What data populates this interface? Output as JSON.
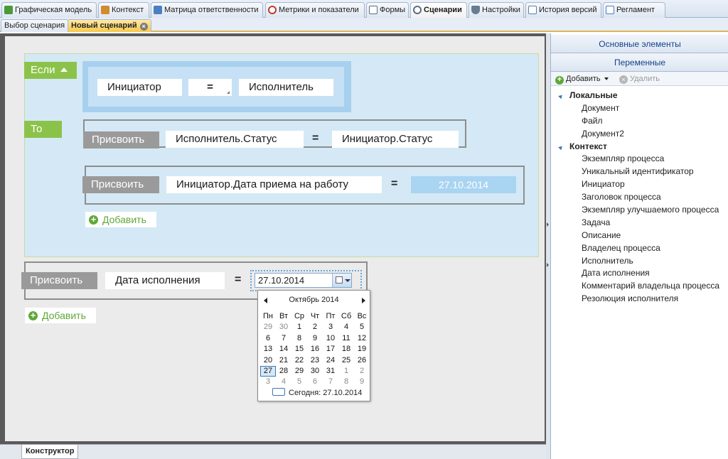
{
  "top_tabs": [
    {
      "label": "Графическая модель",
      "icon": "graph-model-icon",
      "color": "#4a9a3a"
    },
    {
      "label": "Контекст",
      "icon": "context-icon",
      "color": "#d28b2d"
    },
    {
      "label": "Матрица ответственности",
      "icon": "matrix-icon",
      "color": "#4a7fc1"
    },
    {
      "label": "Метрики и показатели",
      "icon": "metrics-icon",
      "color": "#c0392b"
    },
    {
      "label": "Формы",
      "icon": "forms-icon",
      "color": "#5a6d85"
    },
    {
      "label": "Сценарии",
      "icon": "scenarios-icon",
      "color": "#5a6d85"
    },
    {
      "label": "Настройки",
      "icon": "settings-icon",
      "color": "#6a7c92"
    },
    {
      "label": "История версий",
      "icon": "history-icon",
      "color": "#5d7ea8"
    },
    {
      "label": "Регламент",
      "icon": "regulation-icon",
      "color": "#4a7fc1"
    }
  ],
  "sub_tabs": [
    {
      "label": "Выбор сценария"
    },
    {
      "label": "Новый сценарий"
    }
  ],
  "designer": {
    "if_label": "Если",
    "then_label": "То",
    "condition": {
      "left": "Инициатор",
      "operator": "=",
      "right": "Исполнитель"
    },
    "actions": [
      {
        "button": "Присвоить",
        "target": "Исполнитель.Статус",
        "eq": "=",
        "value": "Инициатор.Статус"
      },
      {
        "button": "Присвоить",
        "target": "Инициатор.Дата приема на работу",
        "eq": "=",
        "value": "27.10.2014"
      }
    ],
    "add_inner": "Добавить",
    "outer_action": {
      "button": "Присвоить",
      "target": "Дата исполнения",
      "eq": "=",
      "date_value": "27.10.2014"
    },
    "add_outer": "Добавить"
  },
  "calendar": {
    "month_label": "Октябрь 2014",
    "weekdays": [
      "Пн",
      "Вт",
      "Ср",
      "Чт",
      "Пт",
      "Сб",
      "Вс"
    ],
    "weeks": [
      [
        {
          "d": "29",
          "o": true
        },
        {
          "d": "30",
          "o": true
        },
        {
          "d": "1"
        },
        {
          "d": "2"
        },
        {
          "d": "3"
        },
        {
          "d": "4"
        },
        {
          "d": "5"
        }
      ],
      [
        {
          "d": "6"
        },
        {
          "d": "7"
        },
        {
          "d": "8"
        },
        {
          "d": "9"
        },
        {
          "d": "10"
        },
        {
          "d": "11"
        },
        {
          "d": "12"
        }
      ],
      [
        {
          "d": "13"
        },
        {
          "d": "14"
        },
        {
          "d": "15"
        },
        {
          "d": "16"
        },
        {
          "d": "17"
        },
        {
          "d": "18"
        },
        {
          "d": "19"
        }
      ],
      [
        {
          "d": "20"
        },
        {
          "d": "21"
        },
        {
          "d": "22"
        },
        {
          "d": "23"
        },
        {
          "d": "24"
        },
        {
          "d": "25"
        },
        {
          "d": "26"
        }
      ],
      [
        {
          "d": "27",
          "s": true
        },
        {
          "d": "28"
        },
        {
          "d": "29"
        },
        {
          "d": "30"
        },
        {
          "d": "31"
        },
        {
          "d": "1",
          "o": true
        },
        {
          "d": "2",
          "o": true
        }
      ],
      [
        {
          "d": "3",
          "o": true
        },
        {
          "d": "4",
          "o": true
        },
        {
          "d": "5",
          "o": true
        },
        {
          "d": "6",
          "o": true
        },
        {
          "d": "7",
          "o": true
        },
        {
          "d": "8",
          "o": true
        },
        {
          "d": "9",
          "o": true
        }
      ]
    ],
    "today_label": "Сегодня: 27.10.2014"
  },
  "bottom_tab": "Конструктор",
  "right_panel": {
    "header_main": "Основные элементы",
    "header_vars": "Переменные",
    "toolbar": {
      "add": "Добавить",
      "delete": "Удалить"
    },
    "groups": [
      {
        "name": "Локальные",
        "items": [
          "Документ",
          "Файл",
          "Документ2"
        ]
      },
      {
        "name": "Контекст",
        "items": [
          "Экземпляр процесса",
          "Уникальный идентификатор",
          "Инициатор",
          "Заголовок процесса",
          "Экземпляр улучшаемого процесса",
          "Задача",
          "Описание",
          "Владелец процесса",
          "Исполнитель",
          "Дата исполнения",
          "Комментарий владельца процесса",
          "Резолюция исполнителя"
        ]
      }
    ]
  }
}
